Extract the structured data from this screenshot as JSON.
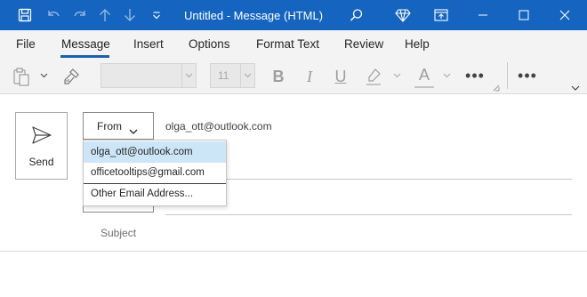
{
  "window": {
    "title": "Untitled  -  Message (HTML)",
    "accent_color": "#1565c0",
    "quick_access_icons": [
      "save-icon",
      "undo-icon",
      "redo-icon",
      "arrow-up-icon",
      "arrow-down-icon",
      "customize-qat-icon"
    ],
    "right_icons": [
      "search-icon",
      "premium-diamond-icon",
      "restore-window-icon",
      "minimize-icon",
      "maximize-icon",
      "close-icon"
    ]
  },
  "menu": {
    "tabs": [
      {
        "label": "File"
      },
      {
        "label": "Message"
      },
      {
        "label": "Insert"
      },
      {
        "label": "Options"
      },
      {
        "label": "Format Text"
      },
      {
        "label": "Review"
      },
      {
        "label": "Help"
      }
    ],
    "active_tab": "Message"
  },
  "ribbon": {
    "font_name": "",
    "font_size": "11",
    "bold": "B",
    "italic": "I",
    "underline": "U",
    "font_color_letter": "A",
    "more_label": "•••",
    "overflow_label": "•••"
  },
  "compose": {
    "send_label": "Send",
    "from_label": "From",
    "from_value": "olga_ott@outlook.com",
    "subject_label": "Subject"
  },
  "from_dropdown": {
    "items": [
      {
        "label": "olga_ott@outlook.com",
        "selected": true
      },
      {
        "label": "officetooltips@gmail.com",
        "selected": false
      },
      {
        "label": "Other Email Address...",
        "selected": false
      }
    ]
  }
}
